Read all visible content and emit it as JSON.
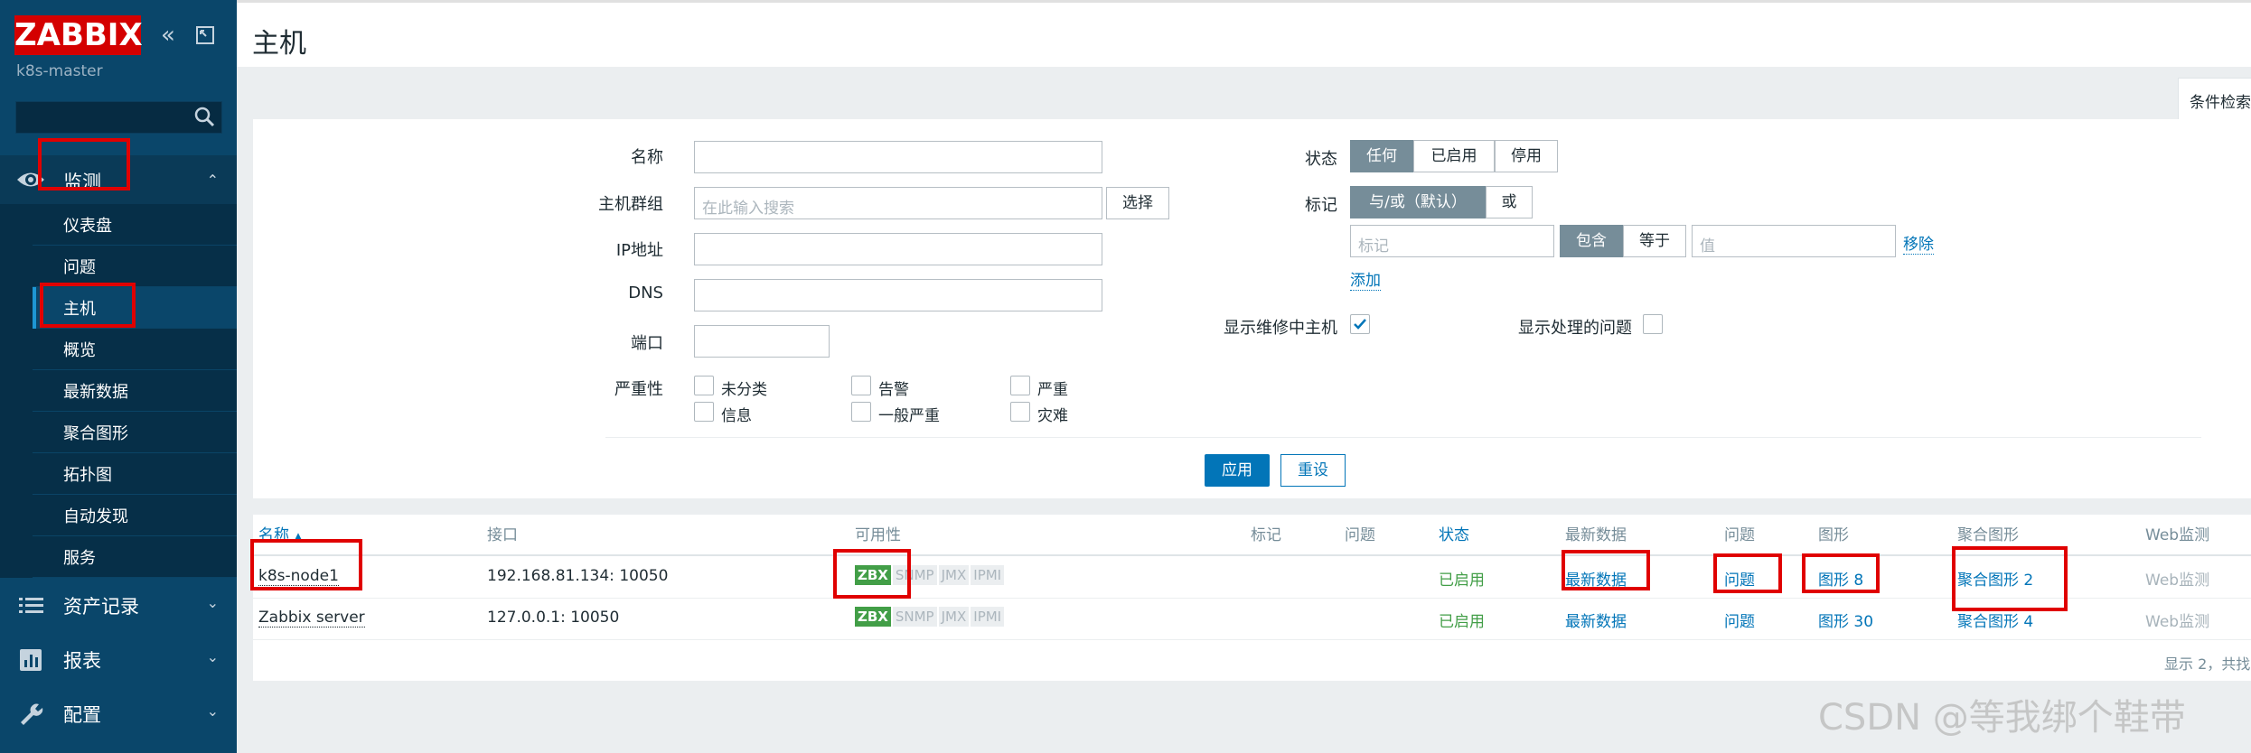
{
  "sidebar": {
    "logo": "ZABBIX",
    "server_name": "k8s-master",
    "search_placeholder": "",
    "monitor": {
      "label": "监测",
      "caret": "⌃"
    },
    "submenu": [
      "仪表盘",
      "问题",
      "主机",
      "概览",
      "最新数据",
      "聚合图形",
      "拓扑图",
      "自动发现",
      "服务"
    ],
    "active_item": "主机",
    "sections": [
      {
        "label": "资产记录",
        "icon": "list-icon",
        "caret": "⌄"
      },
      {
        "label": "报表",
        "icon": "report-icon",
        "caret": "⌄"
      },
      {
        "label": "配置",
        "icon": "wrench-icon",
        "caret": "⌄"
      }
    ]
  },
  "header": {
    "title": "主机",
    "filter_tab": "条件检索"
  },
  "filter": {
    "name_label": "名称",
    "group_label": "主机群组",
    "group_placeholder": "在此输入搜索",
    "select_button": "选择",
    "ip_label": "IP地址",
    "dns_label": "DNS",
    "port_label": "端口",
    "severity_label": "严重性",
    "severities": [
      "未分类",
      "告警",
      "严重",
      "信息",
      "一般严重",
      "灾难"
    ],
    "status_label": "状态",
    "status_options": [
      "任何",
      "已启用",
      "停用"
    ],
    "tags_label": "标记",
    "tag_mode_options": [
      "与/或（默认）",
      "或"
    ],
    "tag_placeholder": "标记",
    "tag_operators": [
      "包含",
      "等于"
    ],
    "value_placeholder": "值",
    "remove_link": "移除",
    "add_link": "添加",
    "maintenance_label": "显示维修中主机",
    "maintenance_checked": true,
    "suppressed_label": "显示处理的问题",
    "suppressed_checked": false,
    "apply_button": "应用",
    "reset_button": "重设"
  },
  "table": {
    "columns": [
      "名称",
      "接口",
      "可用性",
      "标记",
      "问题",
      "状态",
      "最新数据",
      "问题",
      "图形",
      "聚合图形",
      "Web监测"
    ],
    "sort_arrow": "▲",
    "rows": [
      {
        "name": "k8s-node1",
        "interface": "192.168.81.134: 10050",
        "availability": [
          "ZBX",
          "SNMP",
          "JMX",
          "IPMI"
        ],
        "status": "已启用",
        "latest": "最新数据",
        "problems": "问题",
        "graphs": "图形 8",
        "screens": "聚合图形 2",
        "web": "Web监测"
      },
      {
        "name": "Zabbix server",
        "interface": "127.0.0.1: 10050",
        "availability": [
          "ZBX",
          "SNMP",
          "JMX",
          "IPMI"
        ],
        "status": "已启用",
        "latest": "最新数据",
        "problems": "问题",
        "graphs": "图形 30",
        "screens": "聚合图形 4",
        "web": "Web监测"
      }
    ],
    "footer": "显示 2，共找"
  },
  "watermark": "CSDN @等我绑个鞋带",
  "colors": {
    "sidebar": "#0a466a",
    "accent": "#0275b8",
    "logo": "#d40000",
    "enabled": "#429e47",
    "annotation": "#e00000"
  }
}
